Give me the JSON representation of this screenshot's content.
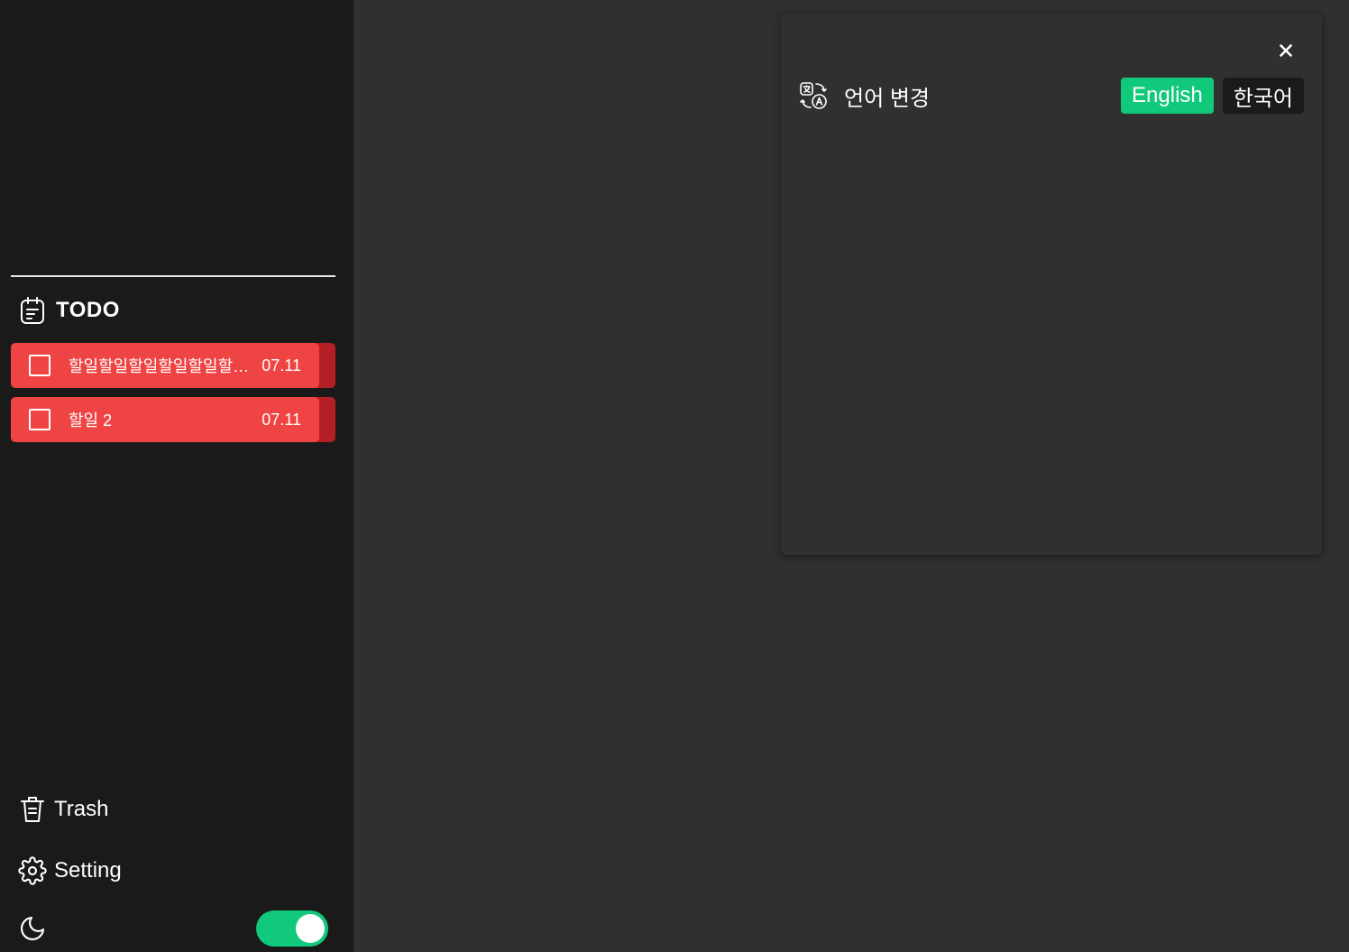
{
  "sidebar": {
    "todo_section": {
      "title": "TODO"
    },
    "todos": [
      {
        "text": "할일할일할일할일할일할일할일할일할일",
        "date": "07.11"
      },
      {
        "text": "할일 2",
        "date": "07.11"
      }
    ],
    "trash_label": "Trash",
    "setting_label": "Setting",
    "dark_mode_enabled": true
  },
  "modal": {
    "language_label": "언어 변경",
    "languages": [
      {
        "label": "English",
        "selected": true
      },
      {
        "label": "한국어",
        "selected": false
      }
    ]
  },
  "colors": {
    "accent": "#10c97a",
    "todo_bg": "#ef4444",
    "sidebar_bg": "#1a1a1a",
    "main_bg": "#303030"
  }
}
